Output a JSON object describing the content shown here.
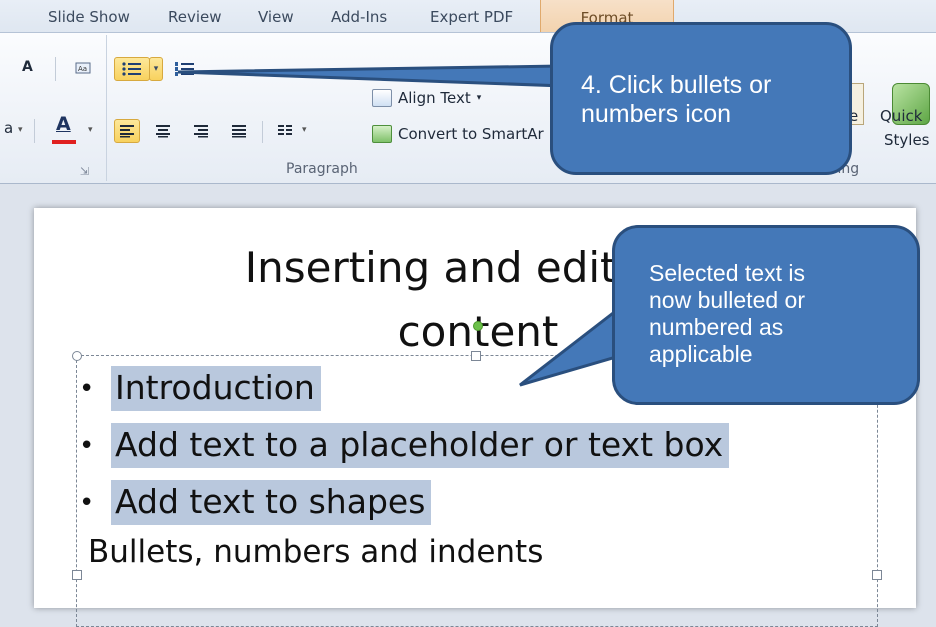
{
  "ribbon_tabs": [
    "Slide Show",
    "Review",
    "View",
    "Add-Ins",
    "Expert PDF",
    "Format"
  ],
  "ribbon": {
    "paragraph_group_label": "Paragraph",
    "align_text_label": "Align Text",
    "convert_smartart_label": "Convert to SmartAr",
    "arrange_partial": "nge",
    "quick_styles_label_1": "Quick",
    "quick_styles_label_2": "Styles",
    "drawing_group_partial": "wing",
    "font_grow_glyph": "A",
    "font_color_glyph": "A",
    "left_partial_glyph": "a",
    "dialog_launcher_glyph": "⇲"
  },
  "slide": {
    "title_line1": "Inserting and editing t",
    "title_line2": "content",
    "bullets": [
      "Introduction",
      "Add text to a placeholder or text box",
      "Add text to shapes"
    ],
    "bullet_symbol": "•",
    "plain_lines": [
      "Bullets, numbers and indents"
    ]
  },
  "callouts": {
    "step4_text": "4. Click bullets or numbers icon",
    "step4_line1": "4. Click bullets or",
    "step4_line2": "numbers icon",
    "result_line1": "Selected text is",
    "result_line2": "now bulleted or",
    "result_line3": "numbered as",
    "result_line4": "applicable"
  },
  "colors": {
    "callout_fill": "#4478b8",
    "callout_border": "#2a4f7e",
    "selection": "#b9c8dd",
    "highlight_button": "#f8d25e",
    "format_tab": "#f3d3ae"
  },
  "icons": {
    "bullets": "bulleted-list-icon",
    "numbering": "numbered-list-icon",
    "align_left": "align-left-icon",
    "align_center": "align-center-icon",
    "align_right": "align-right-icon",
    "justify": "justify-icon",
    "columns": "columns-icon"
  }
}
